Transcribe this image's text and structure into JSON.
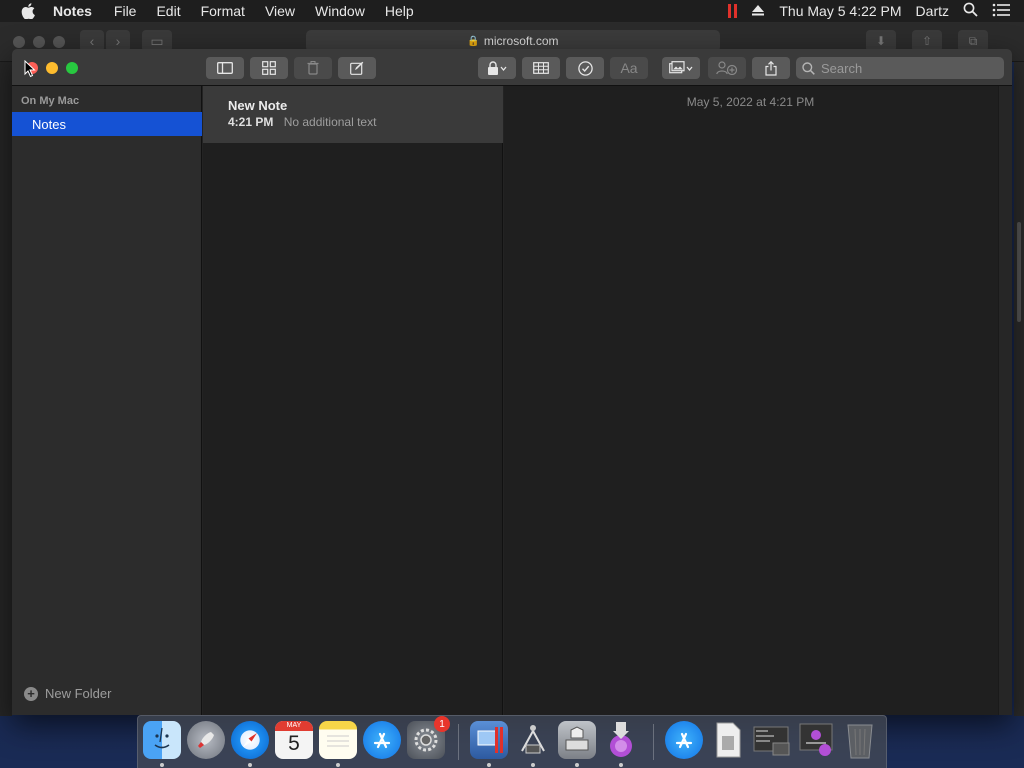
{
  "menubar": {
    "app_name": "Notes",
    "menus": [
      "File",
      "Edit",
      "Format",
      "View",
      "Window",
      "Help"
    ],
    "clock": "Thu May 5  4:22 PM",
    "user": "Dartz"
  },
  "safari": {
    "address": "microsoft.com"
  },
  "notes_window": {
    "toolbar": {
      "search_placeholder": "Search"
    },
    "sidebar": {
      "section_label": "On My Mac",
      "folders": [
        {
          "label": "Notes",
          "selected": true
        }
      ],
      "new_folder_label": "New Folder"
    },
    "note_list": {
      "items": [
        {
          "title": "New Note",
          "time": "4:21 PM",
          "preview": "No additional text"
        }
      ]
    },
    "editor": {
      "date": "May 5, 2022 at 4:21 PM"
    }
  },
  "dock": {
    "apps": [
      "Finder",
      "Launchpad",
      "Safari",
      "Calendar",
      "Notes",
      "App Store",
      "System Preferences",
      "Parallels Desktop",
      "Directory Utility",
      "Boot Camp Assistant",
      "Installer",
      "App Store",
      "Preview",
      "Screenshot",
      "Installer Script"
    ],
    "calendar_month": "MAY",
    "calendar_day": "5",
    "prefs_badge": "1"
  },
  "colors": {
    "selection": "#1552d4",
    "close": "#fd5f57",
    "minimize": "#febc2e",
    "zoom": "#28c840"
  }
}
